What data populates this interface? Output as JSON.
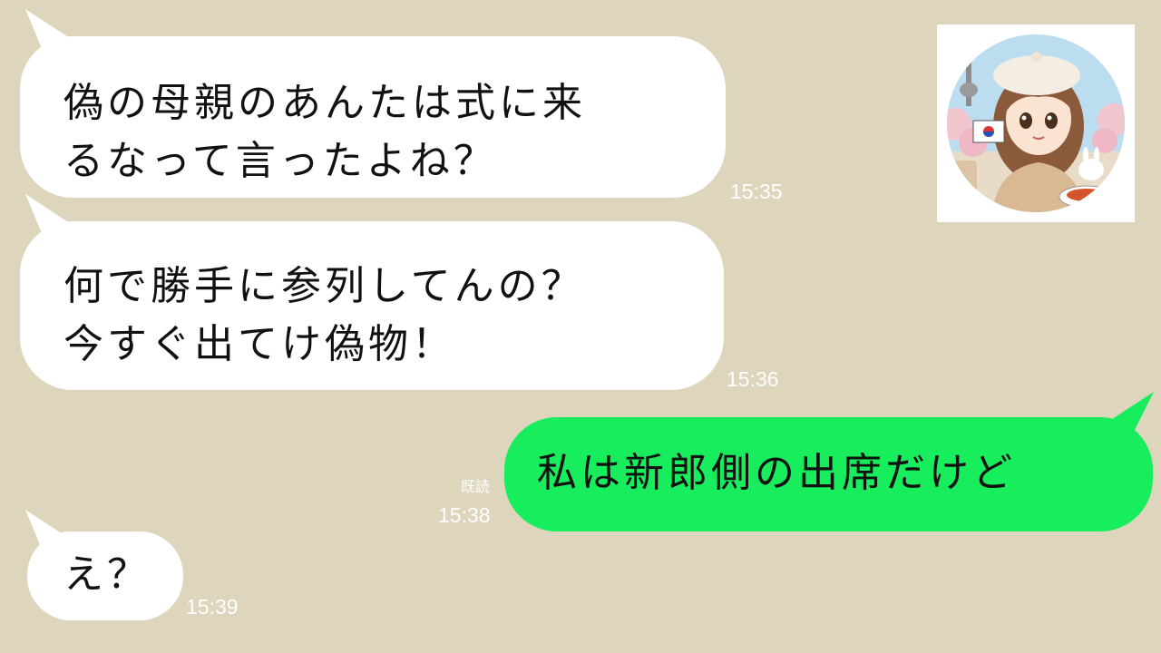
{
  "messages": [
    {
      "side": "incoming",
      "text": "偽の母親のあんたは式に来\nるなって言ったよね？",
      "time": "15:35"
    },
    {
      "side": "incoming",
      "text": "何で勝手に参列してんの？\n今すぐ出てけ偽物！",
      "time": "15:36"
    },
    {
      "side": "outgoing",
      "text": "私は新郎側の出席だけど",
      "time": "15:38",
      "read_label": "既読"
    },
    {
      "side": "incoming",
      "text": "え？",
      "time": "15:39"
    }
  ],
  "avatar": {
    "icon": "girl-avatar-icon",
    "colors": {
      "sky": "#bcdcef",
      "hat": "#f4ede2",
      "hair": "#8a5a3a",
      "sweater": "#d9b894",
      "blossom": "#f2c6cf",
      "flag": "#ffffff"
    }
  },
  "colors": {
    "background": "#ddd5bc",
    "incoming_bubble": "#ffffff",
    "outgoing_bubble": "#18ee5d",
    "timestamp": "#ffffff"
  }
}
